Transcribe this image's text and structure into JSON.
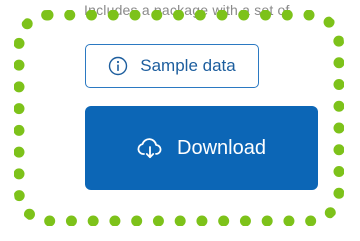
{
  "description": "Includes a package with a set of",
  "sample_button": {
    "label": "Sample data",
    "icon": "info-icon"
  },
  "download_button": {
    "label": "Download",
    "icon": "cloud-download-icon"
  },
  "colors": {
    "primary": "#0c66b6",
    "outline": "#2b79c2",
    "highlight": "#7dc21a",
    "muted_text": "#8a8a8a"
  }
}
